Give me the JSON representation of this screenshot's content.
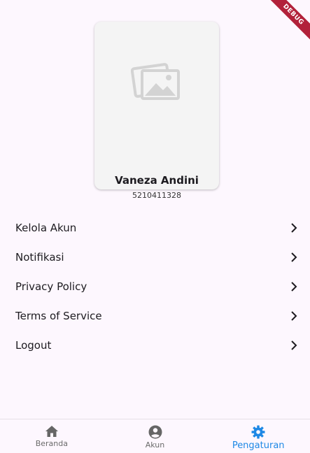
{
  "debug_banner": "DEBUG",
  "profile": {
    "name": "Vaneza Andini",
    "id": "5210411328"
  },
  "settings": [
    {
      "label": "Kelola Akun"
    },
    {
      "label": "Notifikasi"
    },
    {
      "label": "Privacy Policy"
    },
    {
      "label": "Terms of Service"
    },
    {
      "label": "Logout"
    }
  ],
  "nav": {
    "items": [
      {
        "label": "Beranda",
        "icon": "home-icon"
      },
      {
        "label": "Akun",
        "icon": "account-circle-icon"
      },
      {
        "label": "Pengaturan",
        "icon": "gear-icon"
      }
    ],
    "active": "Pengaturan"
  },
  "colors": {
    "background": "#fdf7fe",
    "accent": "#1e88e5",
    "card": "#f4f4f4",
    "inactive_icon": "#666666"
  }
}
